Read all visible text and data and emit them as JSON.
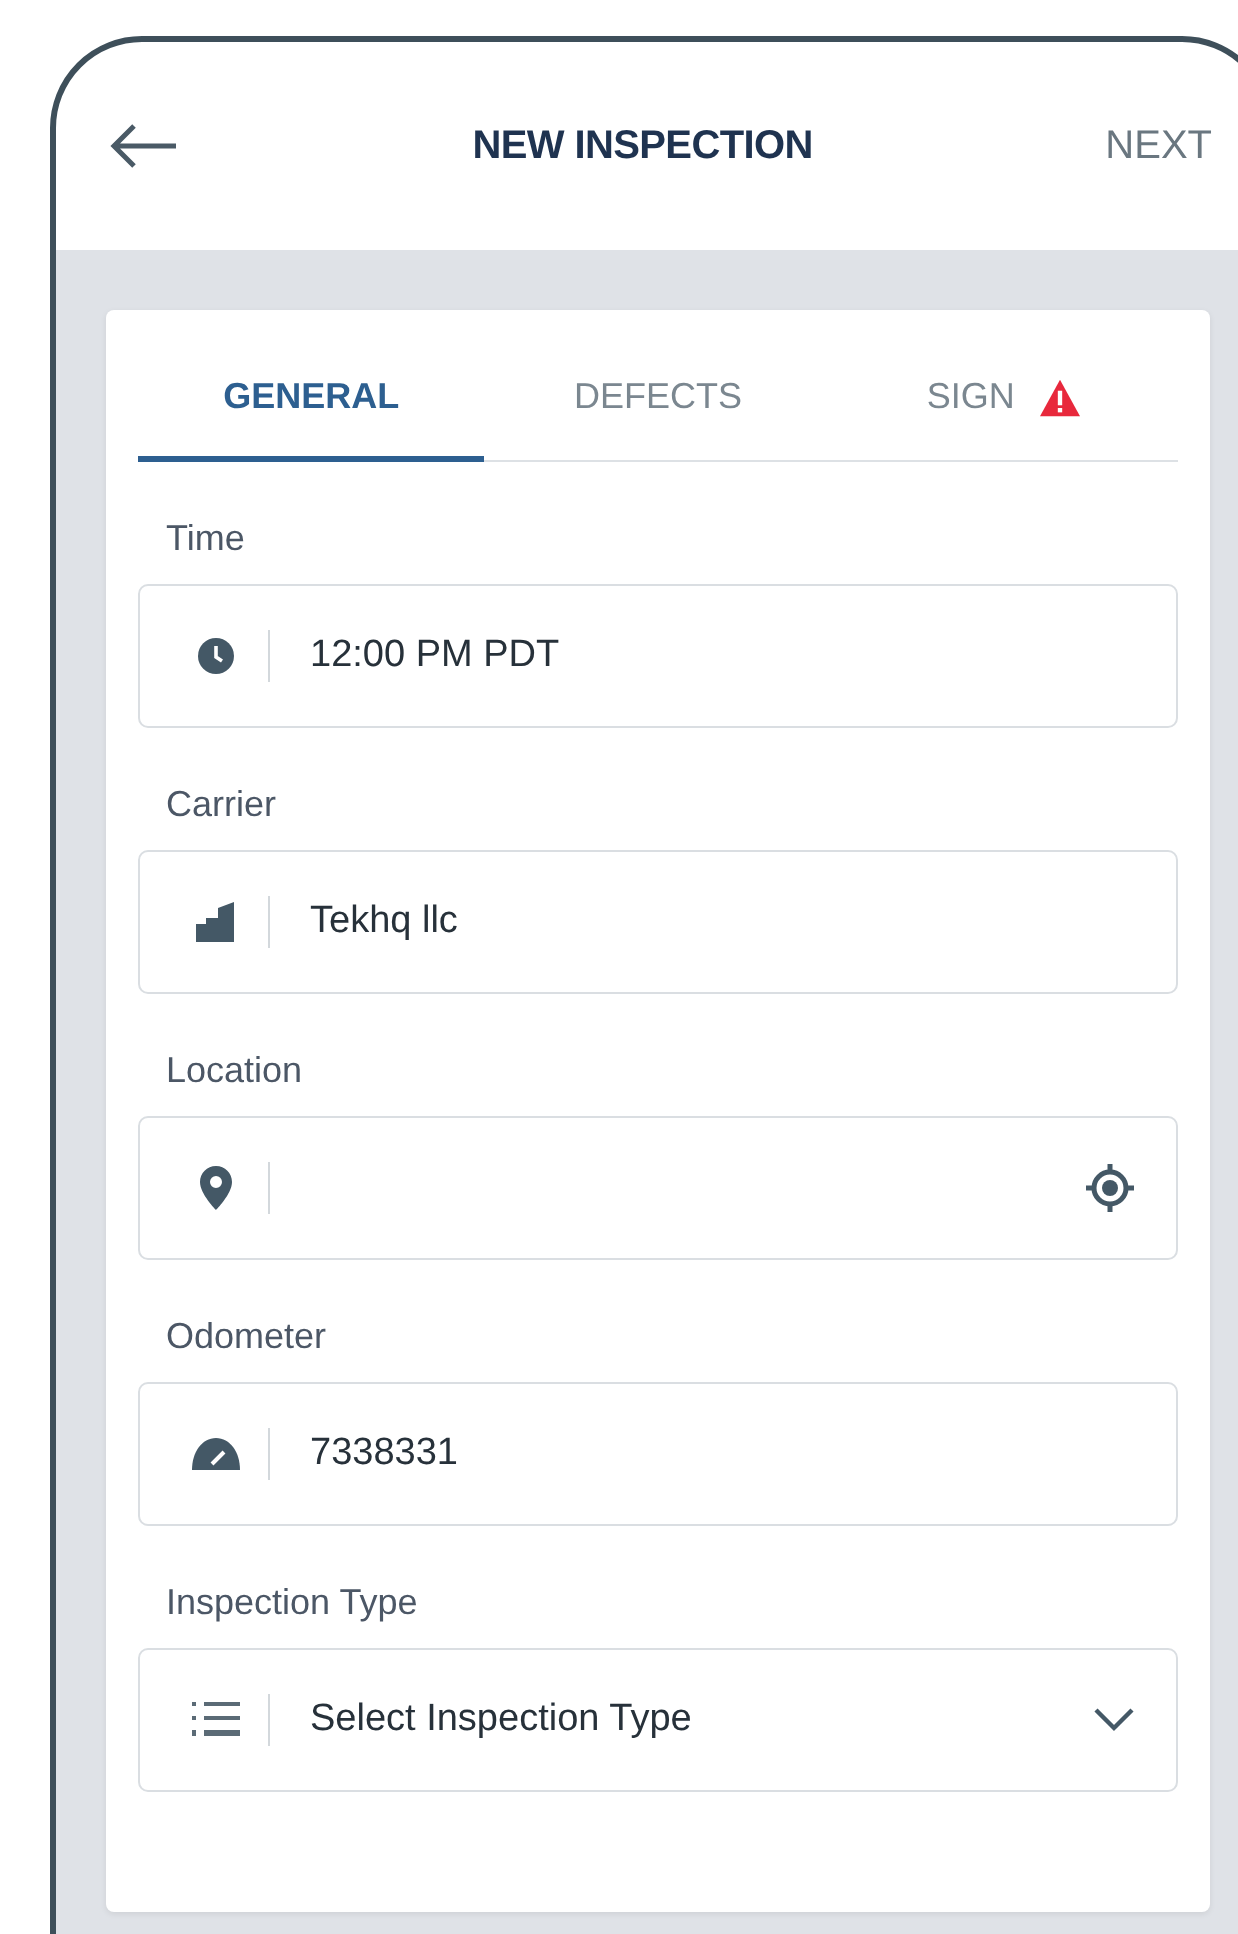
{
  "header": {
    "title": "NEW INSPECTION",
    "action": "NEXT"
  },
  "tabs": [
    {
      "label": "GENERAL",
      "selected": true,
      "alert": false
    },
    {
      "label": "DEFECTS",
      "selected": false,
      "alert": false
    },
    {
      "label": "SIGN",
      "selected": false,
      "alert": true
    }
  ],
  "fields": [
    {
      "kind": "time",
      "label": "Time",
      "value": "12:00 PM PDT"
    },
    {
      "kind": "carrier",
      "label": "Carrier",
      "value": "Tekhq llc"
    },
    {
      "kind": "location",
      "label": "Location"
    },
    {
      "kind": "odometer",
      "label": "Odometer",
      "value": "7338331"
    },
    {
      "kind": "select",
      "label": "Inspection Type",
      "placeholder": "Select Inspection Type"
    }
  ]
}
